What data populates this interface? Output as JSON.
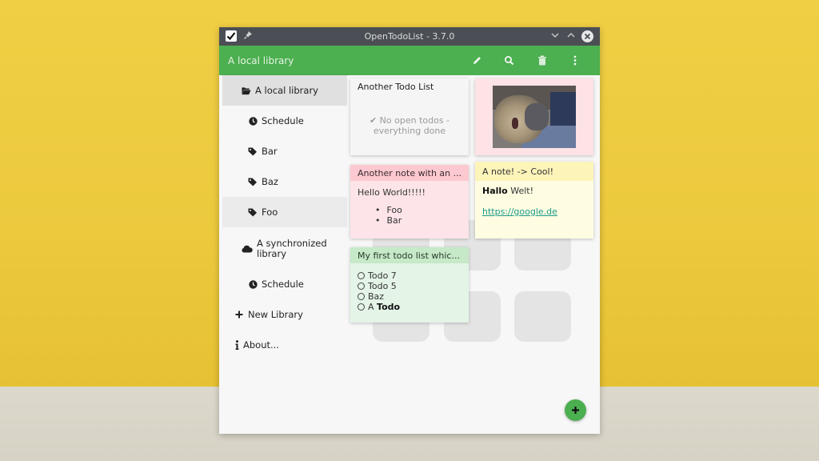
{
  "window": {
    "title": "OpenTodoList - 3.7.0",
    "icons": [
      "app-checkmark-icon",
      "pin-icon",
      "minimize-icon",
      "maximize-icon",
      "close-icon"
    ]
  },
  "appbar": {
    "title": "A local library",
    "actions": [
      {
        "name": "edit",
        "icon": "pencil-icon"
      },
      {
        "name": "search",
        "icon": "search-icon"
      },
      {
        "name": "delete",
        "icon": "trash-icon"
      },
      {
        "name": "more",
        "icon": "more-vertical-icon"
      }
    ],
    "color": "#4caf50"
  },
  "sidebar": {
    "items": [
      {
        "label": "A local library",
        "icon": "folder-open-icon",
        "state": "selected"
      },
      {
        "label": "Schedule",
        "icon": "clock-icon"
      },
      {
        "label": "Bar",
        "icon": "tag-icon"
      },
      {
        "label": "Baz",
        "icon": "tag-icon"
      },
      {
        "label": "Foo",
        "icon": "tag-icon",
        "state": "hover"
      },
      {
        "label": "A synchronized library",
        "icon": "cloud-icon"
      },
      {
        "label": "Schedule",
        "icon": "clock-icon"
      },
      {
        "label": "New Library",
        "icon": "plus-icon"
      },
      {
        "label": "About...",
        "icon": "info-icon"
      }
    ]
  },
  "cards": {
    "todo_list_1": {
      "title": "Another Todo List",
      "empty_text": "✔ No open todos - everything done"
    },
    "image_card": {
      "alt": "cat photo",
      "color": "#fde2e6"
    },
    "note_1": {
      "title": "Another note with an ...",
      "body": "Hello World!!!!!",
      "bullets": [
        "Foo",
        "Bar"
      ],
      "color": "#fde4e8"
    },
    "note_2": {
      "title": "A note! -> Cool!",
      "body_bold": "Hallo",
      "body_rest": " Welt!",
      "link": "https://google.de",
      "color": "#fefde2"
    },
    "todo_list_2": {
      "title": "My first todo list whic...",
      "todos": [
        {
          "text": "Todo 7",
          "bold": ""
        },
        {
          "text": "Todo 5",
          "bold": ""
        },
        {
          "text": "Baz",
          "bold": ""
        },
        {
          "text": "A ",
          "bold": "Todo"
        }
      ],
      "color": "#e4f4e6"
    }
  },
  "fab": {
    "label": "+",
    "icon": "plus-icon"
  }
}
